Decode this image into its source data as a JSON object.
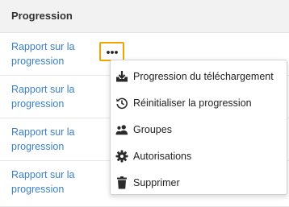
{
  "table": {
    "column_header": "Progression",
    "rows": [
      {
        "link_label": "Rapport sur la progression"
      },
      {
        "link_label": "Rapport sur la progression"
      },
      {
        "link_label": "Rapport sur la progression"
      },
      {
        "link_label": "Rapport sur la progression"
      }
    ]
  },
  "more_button": {
    "icon": "more-horizontal-icon",
    "highlight_color": "#f2a500"
  },
  "menu": {
    "items": [
      {
        "label": "Progression du téléchargement",
        "icon": "download-tray-icon"
      },
      {
        "label": "Réinitialiser la progression",
        "icon": "history-reset-icon"
      },
      {
        "label": "Groupes",
        "icon": "group-users-icon"
      },
      {
        "label": "Autorisations",
        "icon": "gear-icon"
      },
      {
        "label": "Supprimer",
        "icon": "trash-icon"
      }
    ]
  },
  "colors": {
    "link": "#3b80c9",
    "header_bg": "#f2f2f2",
    "icon": "#2b2b2b"
  }
}
